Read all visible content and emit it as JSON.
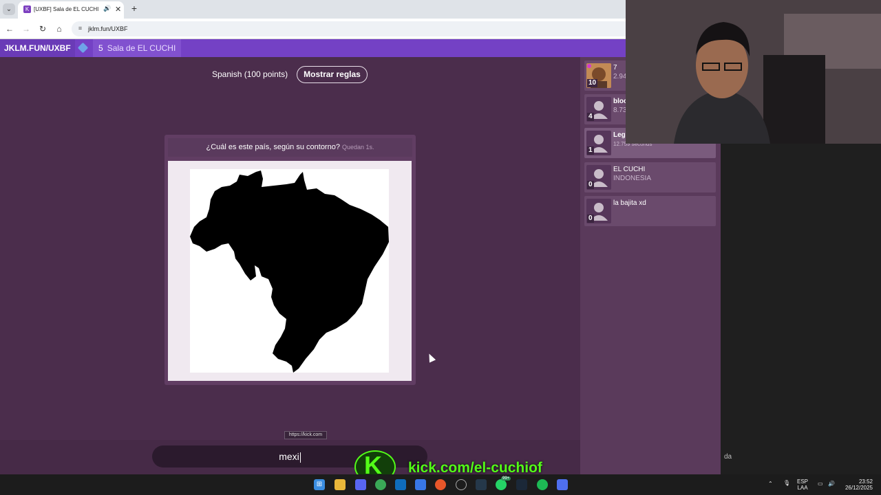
{
  "browser": {
    "tab_title": "[UXBF] Sala de EL CUCHI",
    "favicon_text": "K",
    "url": "jklm.fun/UXBF"
  },
  "site": {
    "brand": "JKLM.FUN/UXBF",
    "room_count": "5",
    "room_name": "Sala de EL CUCHI"
  },
  "game": {
    "dictionary": "Spanish (100 points)",
    "rules_button": "Mostrar reglas",
    "question": "¿Cuál es este país, según su contorno?",
    "timer": "Quedan 1s.",
    "answer_value": "mexi"
  },
  "tooltip": "https://kick.com",
  "players": [
    {
      "name": "7",
      "sub": "2.94",
      "score": "10"
    },
    {
      "name": "bloc",
      "sub": "8.73",
      "score": "4"
    },
    {
      "name": "Leg",
      "sub": "12.759 seconds",
      "score": "1"
    },
    {
      "name": "EL CUCHI",
      "sub": "INDONESIA",
      "score": "0"
    },
    {
      "name": "la bajita xd",
      "sub": "",
      "score": "0"
    }
  ],
  "chat": {
    "last_text": "da"
  },
  "overlay": {
    "kick_letter": "K",
    "kick_url": "kick.com/el-cuchiof"
  },
  "taskbar": {
    "lang_top": "ESP",
    "lang_bottom": "LAA",
    "time": "23:52",
    "date": "26/12/2025",
    "badge": "99+"
  },
  "colors": {
    "accent": "#7441c5",
    "kick": "#53fc18",
    "background": "#4b2d4c"
  }
}
